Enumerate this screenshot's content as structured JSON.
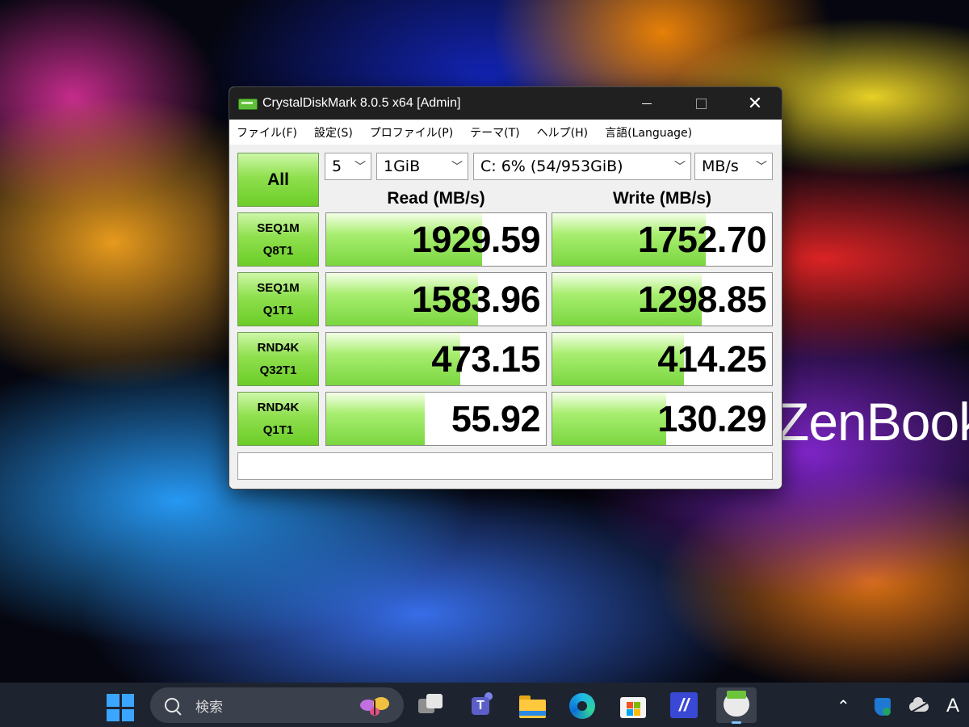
{
  "window": {
    "title": "CrystalDiskMark 8.0.5 x64 [Admin]",
    "controls": {
      "minimize": "minimize",
      "maximize": "maximize",
      "close": "✕"
    }
  },
  "menu": [
    {
      "label": "ファイル(F)"
    },
    {
      "label": "設定(S)"
    },
    {
      "label": "プロファイル(P)"
    },
    {
      "label": "テーマ(T)"
    },
    {
      "label": "ヘルプ(H)"
    },
    {
      "label": "言語(Language)"
    }
  ],
  "controls": {
    "all_button": "All",
    "count": "5",
    "size": "1GiB",
    "drive": "C: 6% (54/953GiB)",
    "unit": "MB/s"
  },
  "headers": {
    "read": "Read (MB/s)",
    "write": "Write (MB/s)"
  },
  "results": [
    {
      "line1": "SEQ1M",
      "line2": "Q8T1",
      "read": "1929.59",
      "write": "1752.70",
      "read_fill": 0.71,
      "write_fill": 0.7
    },
    {
      "line1": "SEQ1M",
      "line2": "Q1T1",
      "read": "1583.96",
      "write": "1298.85",
      "read_fill": 0.69,
      "write_fill": 0.68
    },
    {
      "line1": "RND4K",
      "line2": "Q32T1",
      "read": "473.15",
      "write": "414.25",
      "read_fill": 0.61,
      "write_fill": 0.6
    },
    {
      "line1": "RND4K",
      "line2": "Q1T1",
      "read": "55.92",
      "write": "130.29",
      "read_fill": 0.45,
      "write_fill": 0.52
    }
  ],
  "status": "",
  "desktop": {
    "watermark": "ZenBook"
  },
  "taskbar": {
    "search_placeholder": "検索",
    "ime_indicator": "A",
    "tray_expand": "⌃"
  },
  "colors": {
    "accent_green": "#7ad640",
    "titlebar": "#202020",
    "taskbar": "#1d2430"
  }
}
